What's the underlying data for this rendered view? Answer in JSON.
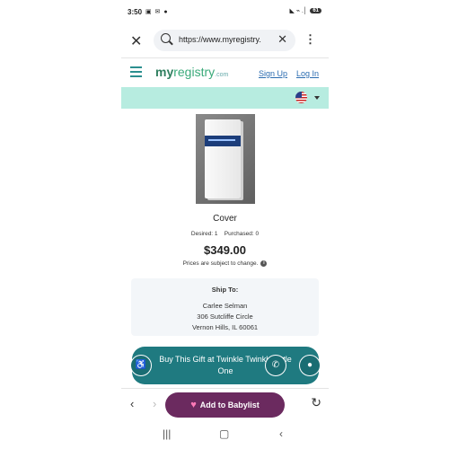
{
  "status_bar": {
    "time": "3:50",
    "notification_icons": "▣ ✉ ●",
    "right_icons": "◣ ⌁ .│",
    "battery": "61"
  },
  "browser": {
    "url": "https://www.myregistry.",
    "close_glyph": "✕",
    "clear_glyph": "✕",
    "menu_glyph": "⋮"
  },
  "site_header": {
    "logo_my": "my",
    "logo_registry": "registry",
    "logo_com": ".com",
    "sign_up": "Sign Up",
    "log_in": "Log In"
  },
  "product": {
    "title": "Cover",
    "desired": "Desired: 1",
    "purchased": "Purchased: 0",
    "price": "$349.00",
    "price_note": "Prices are subject to change.",
    "info_glyph": "i"
  },
  "ship_to": {
    "heading": "Ship To:",
    "name": "Carlee Selman",
    "street": "306 Sutcliffe Circle",
    "city": "Vernon Hills, IL 60061"
  },
  "buy_button": {
    "label": "Buy This Gift at Twinkle Twinkle Little One",
    "phone_glyph": "✆",
    "chat_glyph": "●",
    "accessibility_glyph": "♿"
  },
  "toolbar": {
    "back_glyph": "‹",
    "forward_glyph": "›",
    "add_label": "Add to Babylist",
    "heart_glyph": "♥",
    "reload_glyph": "↻"
  },
  "nav_bar": {
    "recents_glyph": "|||",
    "home_glyph": "▢",
    "back_glyph": "‹"
  },
  "colors": {
    "teal_bar": "#b7ece0",
    "buy_button": "#1f7a80",
    "add_button": "#6b2a5f",
    "link": "#2b6cb0"
  }
}
